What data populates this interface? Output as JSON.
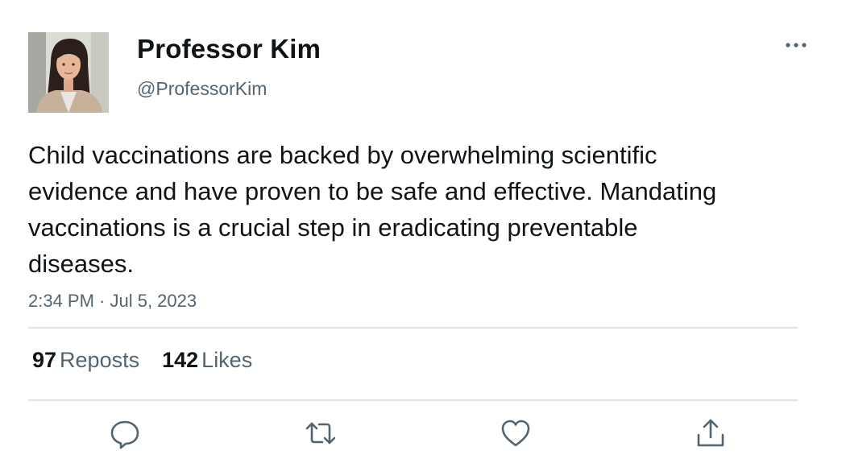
{
  "author": {
    "display_name": "Professor Kim",
    "handle": "@ProfessorKim",
    "avatar_icon": "profile-photo"
  },
  "tweet": {
    "text": "Child vaccinations are backed by overwhelming scientific evidence and have proven to be safe and effective. Mandating vaccinations is a crucial step in eradicating preventable diseases.",
    "timestamp": "2:34 PM · Jul 5, 2023"
  },
  "stats": {
    "reposts_count": "97",
    "reposts_label": "Reposts",
    "likes_count": "142",
    "likes_label": "Likes"
  },
  "actions": [
    {
      "name": "reply",
      "icon": "reply-icon"
    },
    {
      "name": "repost",
      "icon": "repost-icon"
    },
    {
      "name": "like",
      "icon": "heart-icon"
    },
    {
      "name": "share",
      "icon": "share-icon"
    }
  ],
  "colors": {
    "text_primary": "#0f1419",
    "text_secondary": "#536471",
    "divider": "#dfe3e6",
    "icon": "#536471"
  }
}
